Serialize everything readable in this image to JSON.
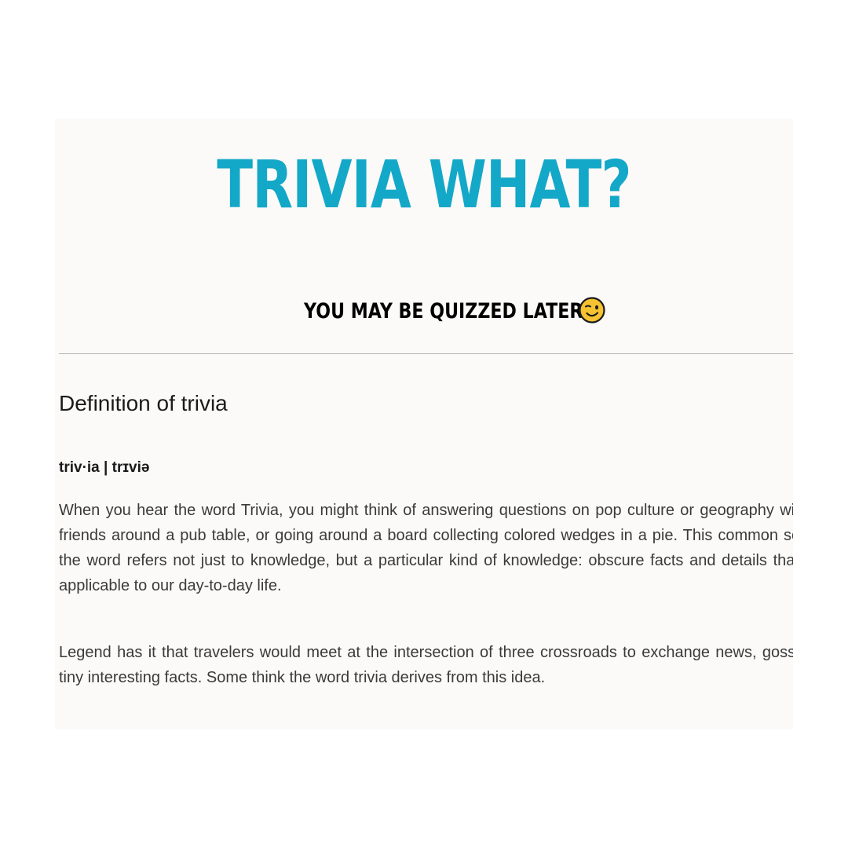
{
  "header": {
    "title": "TRIVIA WHAT?",
    "subtitle": "YOU MAY BE QUIZZED LATER",
    "subtitle_icon": "winking-face-emoji"
  },
  "definition": {
    "heading": "Definition of trivia",
    "pronunciation": "triv·ia | trɪviə",
    "paragraphs": [
      "When you hear the word Trivia, you might think of answering questions on pop culture or geography with your friends around a pub table, or going around a board collecting colored wedges in a pie. This common sense of the word refers not just to knowledge, but a particular kind of knowledge: obscure facts and details that aren't applicable to our day-to-day life.",
      "Legend has it that travelers would meet at the intersection of three crossroads to exchange news, gossip, and tiny interesting facts. Some think the word trivia derives from this idea."
    ]
  },
  "colors": {
    "title": "#14a8c8",
    "card_background": "#fcfaf9",
    "body_text": "#3a3a3a",
    "divider": "#b5b5b5"
  }
}
